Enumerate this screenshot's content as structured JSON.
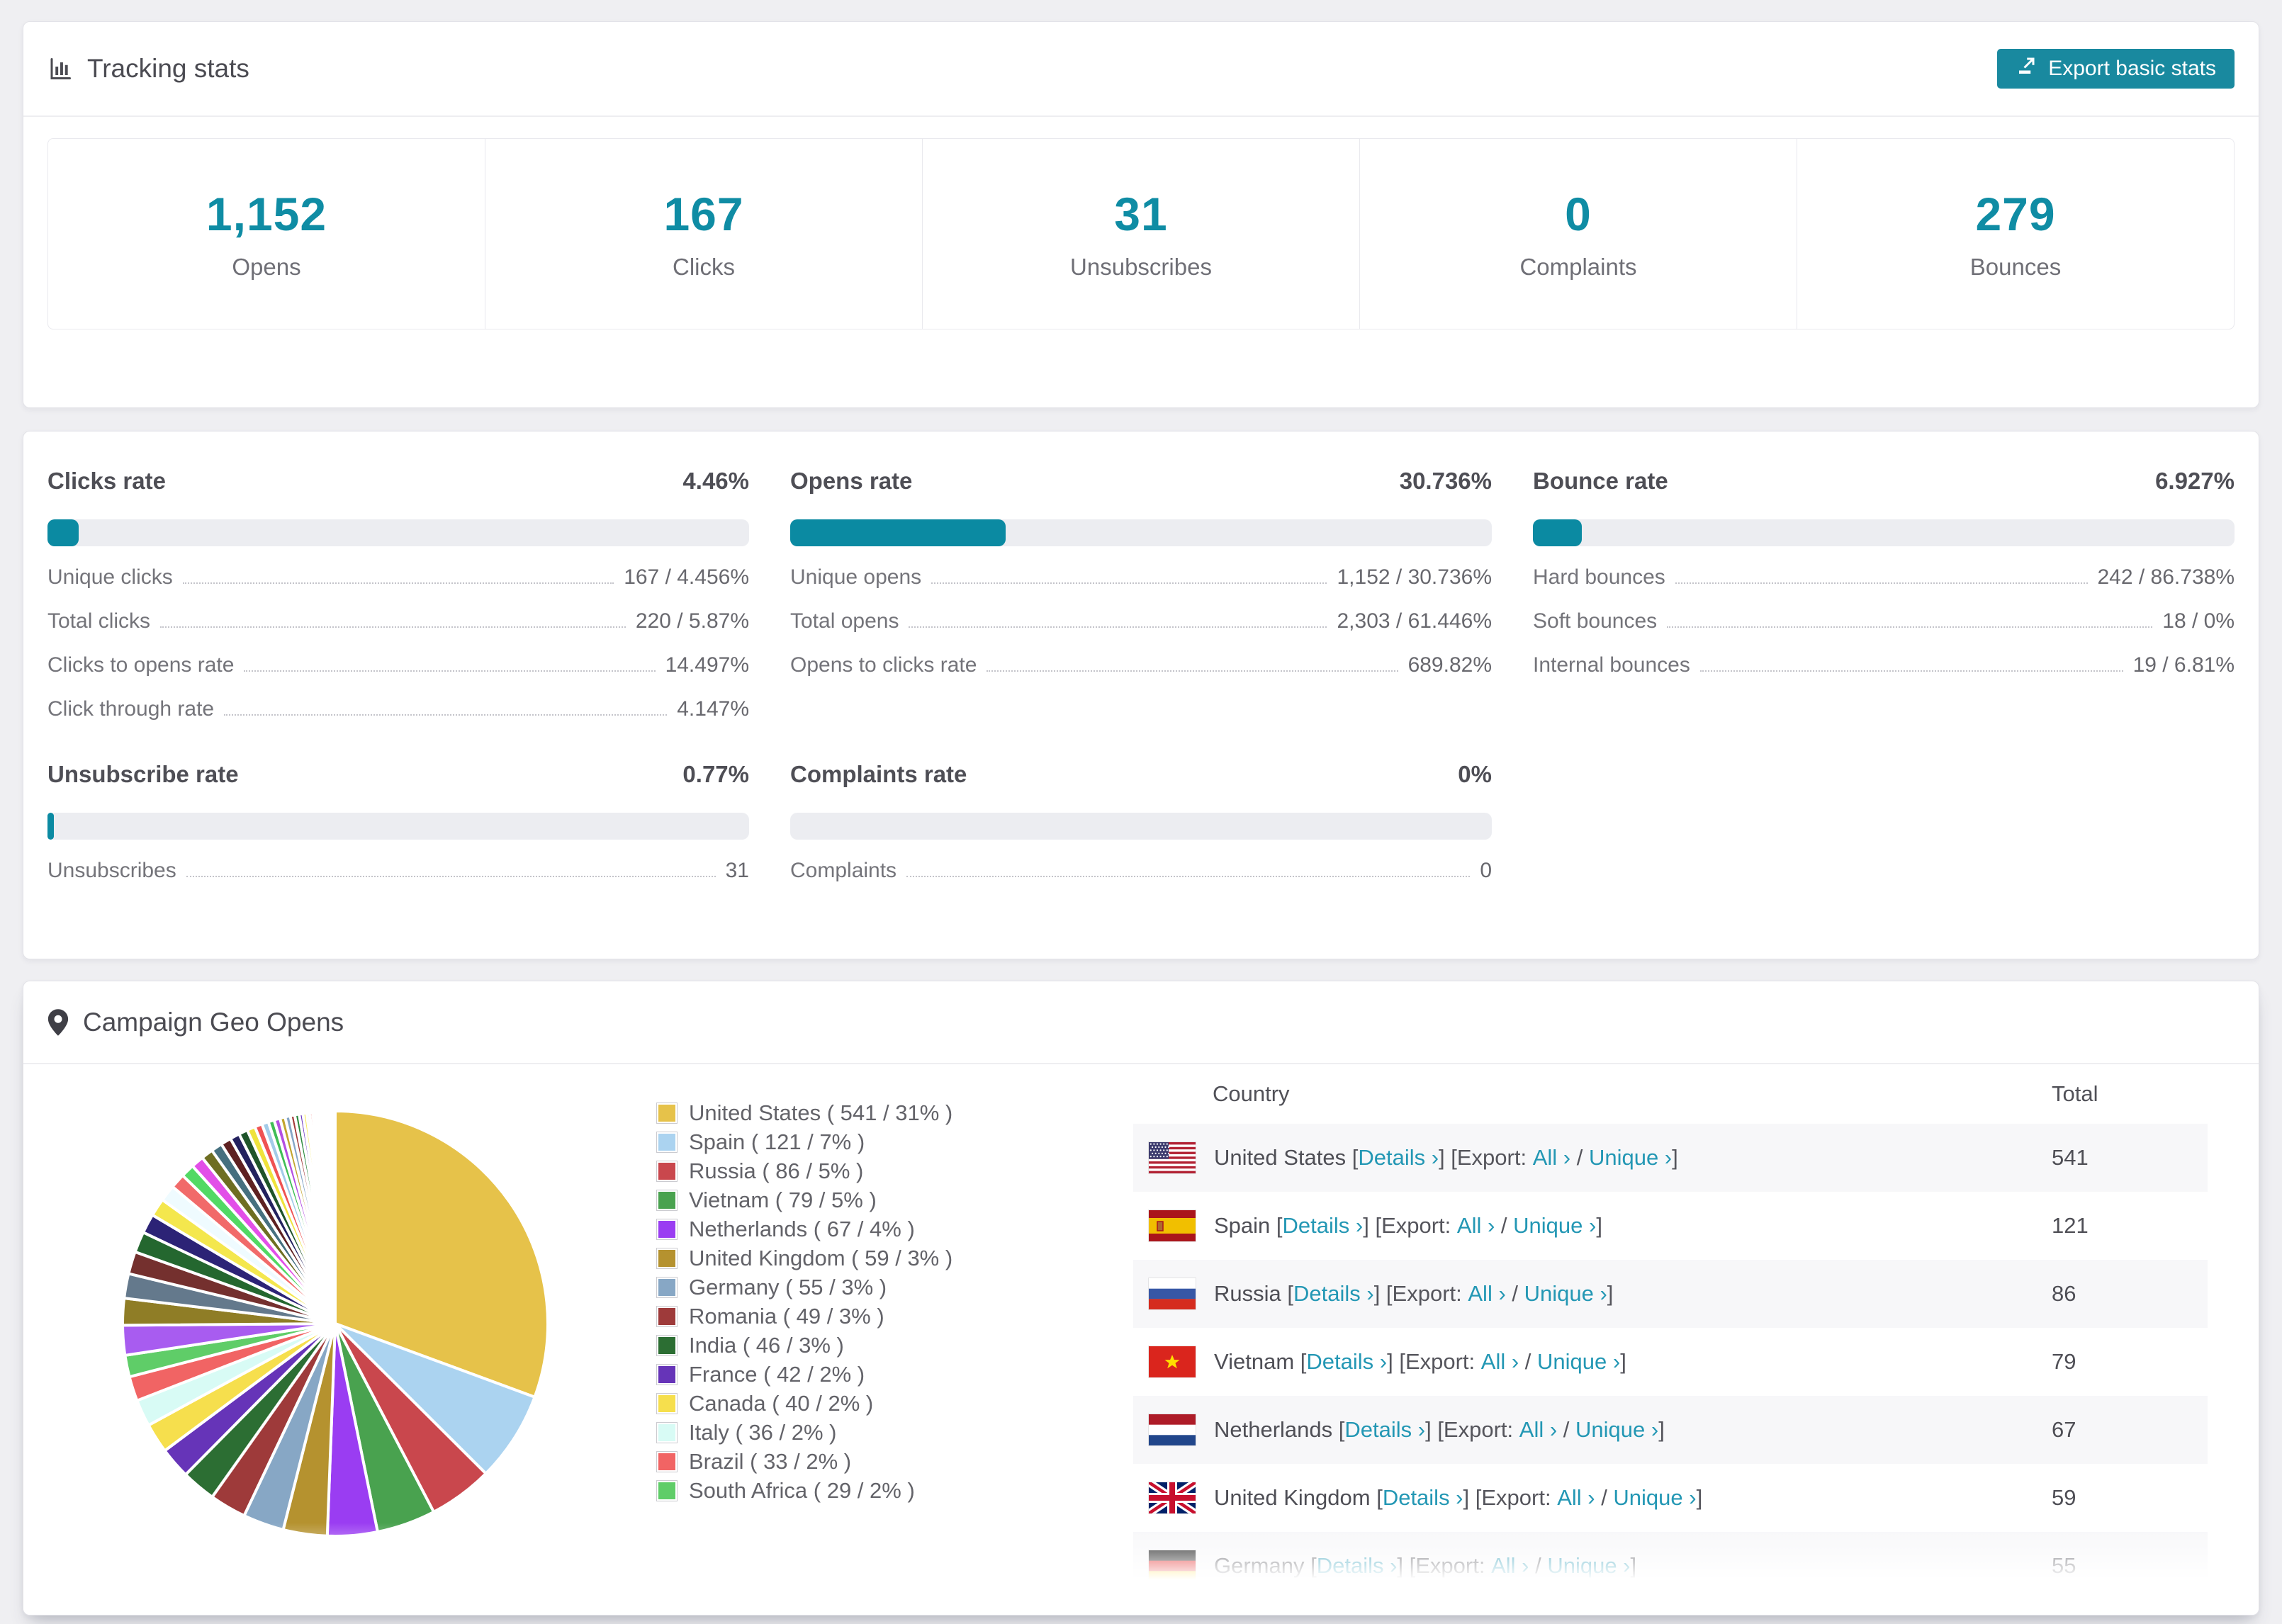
{
  "colors": {
    "teal": "#0b8aa2",
    "button_teal": "#19899f",
    "link_teal": "#2397b4",
    "stat_number": "#0f8ca4"
  },
  "tracking": {
    "title": "Tracking stats",
    "export_label": "Export basic stats",
    "stats": [
      {
        "value": "1,152",
        "label": "Opens"
      },
      {
        "value": "167",
        "label": "Clicks"
      },
      {
        "value": "31",
        "label": "Unsubscribes"
      },
      {
        "value": "0",
        "label": "Complaints"
      },
      {
        "value": "279",
        "label": "Bounces"
      }
    ]
  },
  "rates": [
    {
      "title": "Clicks rate",
      "percent": "4.46%",
      "bar_pct": 4.46,
      "rows": [
        [
          "Unique clicks",
          "167 / 4.456%"
        ],
        [
          "Total clicks",
          "220 / 5.87%"
        ],
        [
          "Clicks to opens rate",
          "14.497%"
        ],
        [
          "Click through rate",
          "4.147%"
        ]
      ]
    },
    {
      "title": "Opens rate",
      "percent": "30.736%",
      "bar_pct": 30.736,
      "rows": [
        [
          "Unique opens",
          "1,152 / 30.736%"
        ],
        [
          "Total opens",
          "2,303 / 61.446%"
        ],
        [
          "Opens to clicks rate",
          "689.82%"
        ]
      ]
    },
    {
      "title": "Bounce rate",
      "percent": "6.927%",
      "bar_pct": 6.927,
      "rows": [
        [
          "Hard bounces",
          "242 / 86.738%"
        ],
        [
          "Soft bounces",
          "18 / 0%"
        ],
        [
          "Internal bounces",
          "19 / 6.81%"
        ]
      ]
    },
    {
      "title": "Unsubscribe rate",
      "percent": "0.77%",
      "bar_pct": 0.77,
      "rows": [
        [
          "Unsubscribes",
          "31"
        ]
      ]
    },
    {
      "title": "Complaints rate",
      "percent": "0%",
      "bar_pct": 0,
      "rows": [
        [
          "Complaints",
          "0"
        ]
      ]
    }
  ],
  "geo": {
    "title": "Campaign Geo Opens",
    "table_headers": {
      "country": "Country",
      "total": "Total"
    },
    "link_parts": {
      "details": "Details ›",
      "export_prefix": "Export:",
      "all": "All ›",
      "unique": "Unique ›"
    },
    "table_visible_rows": 6,
    "partial_row_index": 6
  },
  "chart_data": {
    "type": "pie",
    "title": "Campaign Geo Opens",
    "unit": "opens",
    "legend_position": "right",
    "series": [
      {
        "label": "United States",
        "value": 541,
        "pct": "31%",
        "color": "#e6c24a",
        "flag": "us",
        "legend_label": "United States ( 541 / 31% )"
      },
      {
        "label": "Spain",
        "value": 121,
        "pct": "7%",
        "color": "#abd3f0",
        "flag": "es",
        "legend_label": "Spain ( 121 / 7% )"
      },
      {
        "label": "Russia",
        "value": 86,
        "pct": "5%",
        "color": "#c9474d",
        "flag": "ru",
        "legend_label": "Russia ( 86 / 5% )"
      },
      {
        "label": "Vietnam",
        "value": 79,
        "pct": "5%",
        "color": "#49a24f",
        "flag": "vn",
        "legend_label": "Vietnam ( 79 / 5% )"
      },
      {
        "label": "Netherlands",
        "value": 67,
        "pct": "4%",
        "color": "#9a3df2",
        "flag": "nl",
        "legend_label": "Netherlands ( 67 / 4% )"
      },
      {
        "label": "United Kingdom",
        "value": 59,
        "pct": "3%",
        "color": "#b5922f",
        "flag": "gb",
        "legend_label": "United Kingdom ( 59 / 3% )"
      },
      {
        "label": "Germany",
        "value": 55,
        "pct": "3%",
        "color": "#87a7c5",
        "flag": "de",
        "legend_label": "Germany ( 55 / 3% )"
      },
      {
        "label": "Romania",
        "value": 49,
        "pct": "3%",
        "color": "#9e3a3a",
        "flag": "ro",
        "legend_label": "Romania ( 49 / 3% )"
      },
      {
        "label": "India",
        "value": 46,
        "pct": "3%",
        "color": "#2c6e33",
        "flag": "in",
        "legend_label": "India ( 46 / 3% )"
      },
      {
        "label": "France",
        "value": 42,
        "pct": "2%",
        "color": "#6634b8",
        "flag": "fr",
        "legend_label": "France ( 42 / 2% )"
      },
      {
        "label": "Canada",
        "value": 40,
        "pct": "2%",
        "color": "#f6df4d",
        "flag": "ca",
        "legend_label": "Canada ( 40 / 2% )"
      },
      {
        "label": "Italy",
        "value": 36,
        "pct": "2%",
        "color": "#d8fbf5",
        "flag": "it",
        "legend_label": "Italy ( 36 / 2% )"
      },
      {
        "label": "Brazil",
        "value": 33,
        "pct": "2%",
        "color": "#f16464",
        "flag": "br",
        "legend_label": "Brazil ( 33 / 2% )"
      },
      {
        "label": "South Africa",
        "value": 29,
        "pct": "2%",
        "color": "#5fcd68",
        "flag": "za",
        "legend_label": "South Africa ( 29 / 2% )"
      }
    ],
    "others_estimated_values": [
      40,
      36,
      33,
      30,
      28,
      26,
      24,
      22,
      20,
      18,
      17,
      16,
      15,
      14,
      13,
      12,
      11,
      10,
      9,
      8,
      8,
      7,
      7,
      6,
      6,
      5,
      5,
      4,
      4,
      3,
      3,
      3,
      2,
      2,
      2,
      2,
      2,
      1,
      1,
      1,
      1,
      1,
      1,
      1,
      1,
      1,
      1,
      1
    ],
    "others_colors": [
      "#a85cf0",
      "#8f7d26",
      "#64798c",
      "#74302e",
      "#24672f",
      "#2c2376",
      "#f4e74d",
      "#effbff",
      "#f16a6a",
      "#52d964",
      "#e24fe8",
      "#6e6e22",
      "#46707f",
      "#5e2121",
      "#23215e",
      "#1f5429",
      "#efe33c",
      "#ef5252",
      "#a3cbe8",
      "#3fbd56",
      "#b44fe2",
      "#c2a52e",
      "#86a6c6",
      "#a23a3a",
      "#2d8a3e",
      "#6d3ac2",
      "#f6ec5e",
      "#dff8f2",
      "#f67b7b",
      "#6fd982",
      "#ef62e2",
      "#938b20",
      "#5f8a9b",
      "#732b2b",
      "#2b2b85",
      "#226234",
      "#ead93e",
      "#e86464",
      "#aed6f1",
      "#4fc25e",
      "#c974ef",
      "#d9b93a",
      "#9ab8d3",
      "#b04848",
      "#3da04e",
      "#8456d9",
      "#f8f098",
      "#c2f2e6"
    ]
  }
}
